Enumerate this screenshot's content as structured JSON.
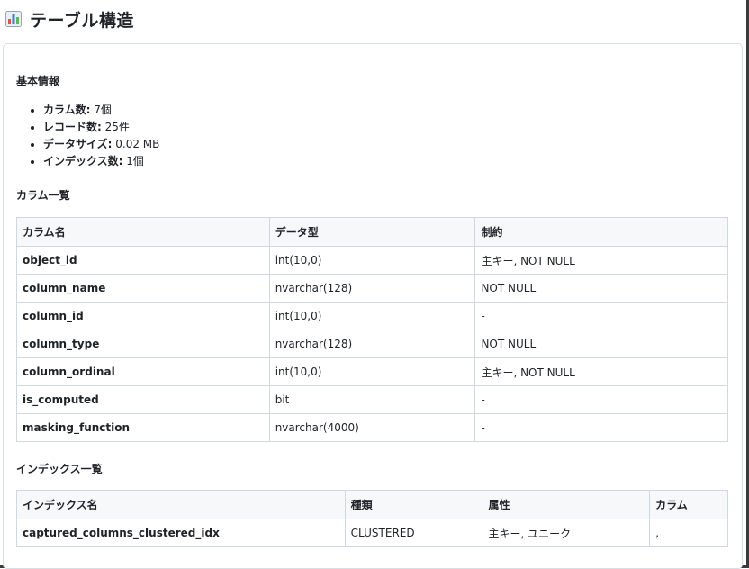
{
  "page": {
    "title": "テーブル構造",
    "icon": "bar-chart-icon"
  },
  "basic_info": {
    "heading": "基本情報",
    "items": [
      {
        "label": "カラム数:",
        "value": " 7個"
      },
      {
        "label": "レコード数:",
        "value": " 25件"
      },
      {
        "label": "データサイズ:",
        "value": " 0.02 MB"
      },
      {
        "label": "インデックス数:",
        "value": " 1個"
      }
    ]
  },
  "columns": {
    "heading": "カラム一覧",
    "headers": [
      "カラム名",
      "データ型",
      "制約"
    ],
    "rows": [
      [
        "object_id",
        "int(10,0)",
        "主キー, NOT NULL"
      ],
      [
        "column_name",
        "nvarchar(128)",
        "NOT NULL"
      ],
      [
        "column_id",
        "int(10,0)",
        "-"
      ],
      [
        "column_type",
        "nvarchar(128)",
        "NOT NULL"
      ],
      [
        "column_ordinal",
        "int(10,0)",
        "主キー, NOT NULL"
      ],
      [
        "is_computed",
        "bit",
        "-"
      ],
      [
        "masking_function",
        "nvarchar(4000)",
        "-"
      ]
    ]
  },
  "indexes": {
    "heading": "インデックス一覧",
    "headers": [
      "インデックス名",
      "種類",
      "属性",
      "カラム"
    ],
    "rows": [
      [
        "captured_columns_clustered_idx",
        "CLUSTERED",
        "主キー, ユニーク",
        ","
      ]
    ]
  },
  "colors": {
    "header_bg": "#f6f8fa",
    "border": "#d0d7de",
    "text": "#1f2328"
  }
}
